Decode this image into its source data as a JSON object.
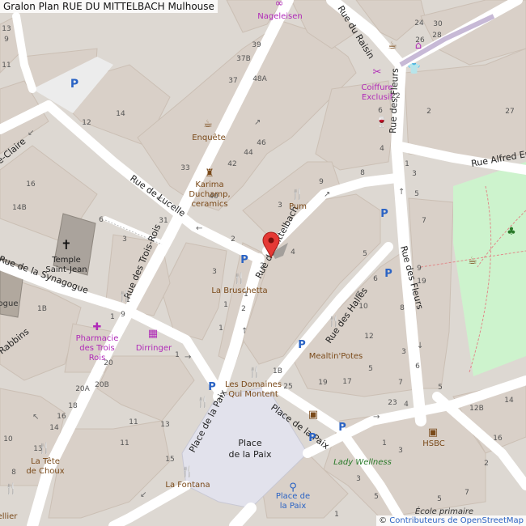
{
  "title": "Gralon Plan RUE DU MITTELBACH Mulhouse",
  "attribution": {
    "prefix": "© ",
    "link_text": "Contributeurs de OpenStreetMap"
  },
  "colors": {
    "building": "#d9d0c8",
    "background": "#ddd8d2",
    "road": "#ffffff",
    "square": "#e2e2ec",
    "park": "#cdf3cd",
    "religious": "#aaa39c",
    "marker": "#e53935",
    "brown_poi": "#7a4a1a",
    "purple_poi": "#b02ab8",
    "blue_poi": "#2a63c4"
  },
  "streets": {
    "rue_de_lucelle": "Rue de Lucelle",
    "rue_des_trois_rois": "Rue des Trois-Rois",
    "rue_du_mittelbach": "Rue du Mittelbach",
    "rue_de_la_synagogue": "Rue de la Synagogue",
    "rue_des_rabbins": "Rabbins",
    "rue_des_halles": "Rue des Halles",
    "rue_des_fleurs_upper": "Rue des Fleurs",
    "rue_des_fleurs_lower": "Rue des Fleurs",
    "rue_du_raisin": "Rue du Raisin",
    "rue_alfred": "Rue Alfred En",
    "place_de_la_paix_sw": "Place de la Paix",
    "place_de_la_paix_se": "Place de la Paix",
    "rue_claire": "e-Claire"
  },
  "places": {
    "place_de_la_paix_1": "Place",
    "place_de_la_paix_2": "de la Paix",
    "temple_1": "Temple",
    "temple_2": "Saint-Jean"
  },
  "pois": {
    "nageleisen": "Nageleisen",
    "coiffure_1": "Coiffure",
    "coiffure_2": "Exclusif",
    "enquete": "Enquête",
    "karima_1": "Karima",
    "karima_2": "Duchamp,",
    "karima_3": "ceramics",
    "pum": "Pum",
    "bruschetta": "La Bruschetta",
    "pharmacie_1": "Pharmacie",
    "pharmacie_2": "des Trois",
    "pharmacie_3": "Rois",
    "dirringer": "Dirringer",
    "mealtin": "Mealtin'Potes",
    "domaines_1": "Les Domaines",
    "domaines_2": "Qui Montent",
    "tete_1": "La Tête",
    "tete_2": "de Choux",
    "fontana": "La Fontana",
    "hsbc": "HSBC",
    "lady_wellness": "Lady Wellness",
    "velo_1": "Place de",
    "velo_2": "la Paix",
    "ecole": "École primaire",
    "sellier": "ellier",
    "ogue": "ogue"
  },
  "house_numbers": {
    "n13a": "13",
    "n9a": "9",
    "n11": "11",
    "n14a": "14",
    "n12a": "12",
    "n16": "16",
    "n14b": "14B",
    "n6": "6",
    "n3a": "3",
    "n31": "31",
    "n33": "33",
    "n39": "39",
    "n37b": "37B",
    "n37": "37",
    "n48a": "48A",
    "n44": "44",
    "n46": "46",
    "n42": "42",
    "n40": "40",
    "n3b": "3",
    "n9b": "9",
    "n4": "4",
    "n2a": "2",
    "n2b": "2",
    "n5a": "5",
    "n1a": "1",
    "n3c": "3",
    "n1b": "1",
    "n2c": "2",
    "n1c": "1",
    "n1d": "1",
    "n1e": "1",
    "n1b2": "1B",
    "n4b": "4",
    "n6b": "6",
    "n8": "8",
    "n10": "10",
    "n12": "12",
    "n3d": "3",
    "n5b": "5",
    "n7": "7",
    "n17": "17",
    "n19": "19",
    "n23": "23",
    "n25": "25",
    "n20": "20",
    "n20b": "20B",
    "n20a": "20A",
    "n18": "18",
    "n16b": "16",
    "n14c": "14",
    "n10b": "10",
    "n8b": "8",
    "n9c": "9",
    "n11b": "11",
    "n13b": "13",
    "n15": "15",
    "n1f": "1",
    "n3e": "3",
    "n5c": "5",
    "n12b": "12B",
    "n14d": "14",
    "n16c": "16",
    "n2d": "2",
    "n4c": "4",
    "n6c": "6",
    "n24": "24",
    "n30": "30",
    "n22": "22",
    "n28": "28",
    "n26": "26",
    "n1g": "1",
    "n2e": "2",
    "n3f": "3",
    "n5d": "5",
    "n7b": "7",
    "n9d": "9",
    "n19b": "19",
    "n6d": "6",
    "n8c": "8",
    "n4d": "4",
    "n27": "27",
    "n3g": "3",
    "n1h": "1",
    "n5e": "5",
    "n7c": "7",
    "n13c": "13",
    "n11c": "11",
    "n1b3": "1B",
    "n5f": "5",
    "n1i": "1"
  }
}
